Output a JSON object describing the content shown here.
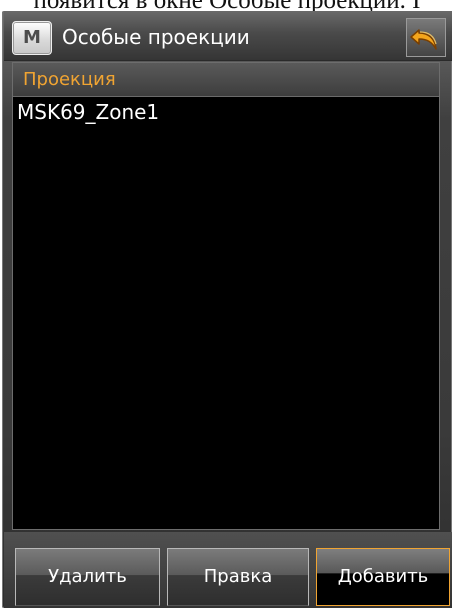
{
  "top_text": "появится в окне Особые проекции. I",
  "titlebar": {
    "menu_icon": "М",
    "title": "Особые проекции",
    "back_icon": "back-arrow-icon"
  },
  "list": {
    "column_header": "Проекция",
    "items": [
      {
        "name": "MSK69_Zone1"
      }
    ]
  },
  "buttons": {
    "delete_label": "Удалить",
    "edit_label": "Правка",
    "add_label": "Добавить"
  },
  "colors": {
    "accent": "#f0a432",
    "list_background": "#000000",
    "toolbar_background": "#3a3a3a"
  }
}
